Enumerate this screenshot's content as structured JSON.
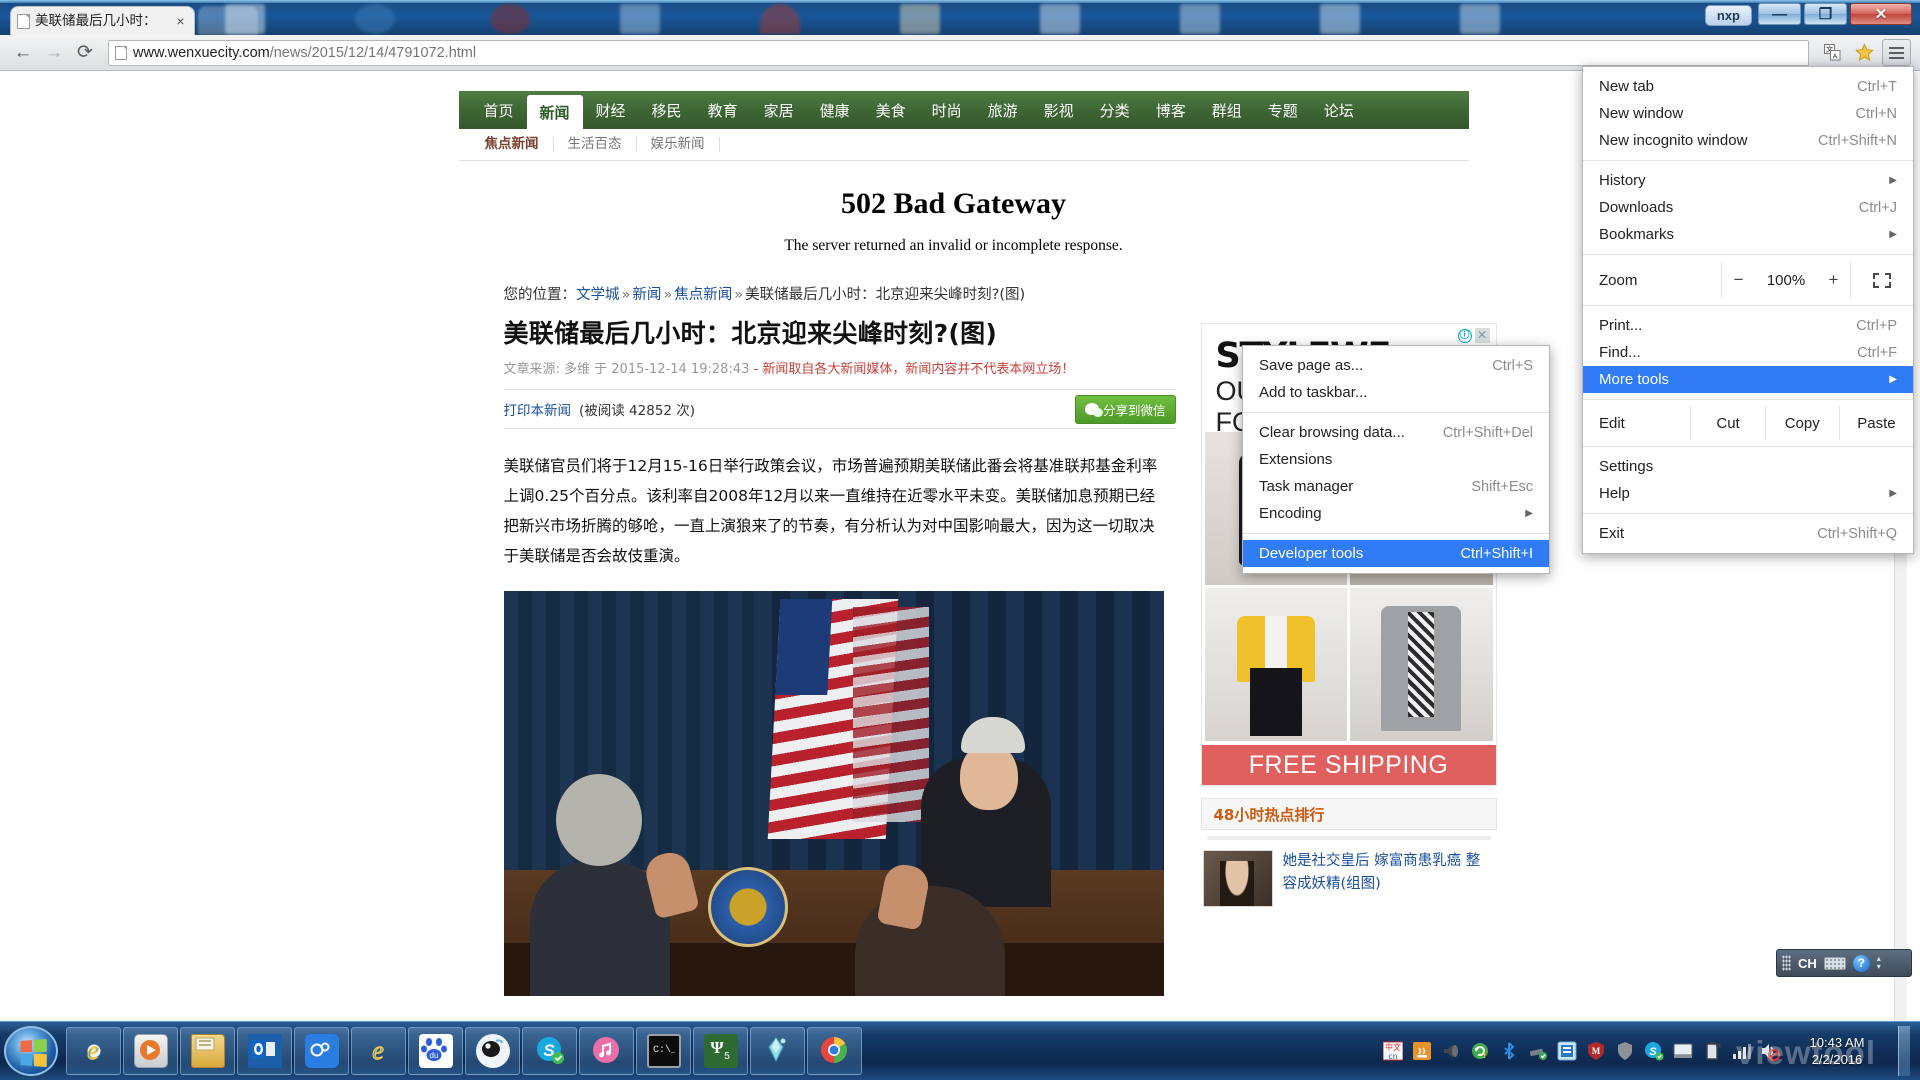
{
  "window": {
    "tab_title": "美联储最后几小时：",
    "tab_close": "×",
    "nxp_badge": "nxp",
    "minimize": "—",
    "maximize": "❐",
    "close": "✕"
  },
  "toolbar": {
    "back": "←",
    "forward": "→",
    "reload": "⟳",
    "url_main": "www.wenxuecity.com",
    "url_path": "/news/2015/12/14/4791072.html",
    "translate_icon": "translate-icon",
    "bookmark_icon": "star-icon",
    "menu_icon": "hamburger-menu-icon"
  },
  "site_nav": {
    "items": [
      {
        "label": "首页",
        "active": false
      },
      {
        "label": "新闻",
        "active": true
      },
      {
        "label": "财经",
        "active": false
      },
      {
        "label": "移民",
        "active": false
      },
      {
        "label": "教育",
        "active": false
      },
      {
        "label": "家居",
        "active": false
      },
      {
        "label": "健康",
        "active": false
      },
      {
        "label": "美食",
        "active": false
      },
      {
        "label": "时尚",
        "active": false
      },
      {
        "label": "旅游",
        "active": false
      },
      {
        "label": "影视",
        "active": false
      },
      {
        "label": "分类",
        "active": false
      },
      {
        "label": "博客",
        "active": false
      },
      {
        "label": "群组",
        "active": false
      },
      {
        "label": "专题",
        "active": false
      },
      {
        "label": "论坛",
        "active": false
      }
    ],
    "subnav": [
      {
        "label": "焦点新闻",
        "active": true
      },
      {
        "label": "生活百态",
        "active": false
      },
      {
        "label": "娱乐新闻",
        "active": false
      }
    ]
  },
  "error": {
    "title": "502 Bad Gateway",
    "subtitle": "The server returned an invalid or incomplete response."
  },
  "breadcrumb": {
    "prefix": "您的位置：",
    "l1": "文学城",
    "l2": "新闻",
    "l3": "焦点新闻",
    "current": "美联储最后几小时：北京迎来尖峰时刻?(图)",
    "sep": "»"
  },
  "article": {
    "title": "美联储最后几小时：北京迎来尖峰时刻?(图)",
    "meta_source": "文章来源: 多维 于 2015-12-14 19:28:43",
    "meta_note": "- 新闻取自各大新闻媒体，新闻内容并不代表本网立场！",
    "print_link": "打印本新闻",
    "read_count": "(被阅读 42852 次)",
    "share_label": "分享到微信",
    "body": "美联储官员们将于12月15-16日举行政策会议，市场普遍预期美联储此番会将基准联邦基金利率上调0.25个百分点。该利率自2008年12月以来一直维持在近零水平未变。美联储加息预期已经把新兴市场折腾的够呛，一直上演狼来了的节奏，有分析认为对中国影响最大，因为这一切取决于美联储是否会故伎重演。"
  },
  "ad": {
    "brand": "STYLEWE",
    "line1": "OUTERWEAR",
    "line2": "FOR W",
    "info_icon": "ⓘ",
    "close_icon": "✕",
    "free_shipping": "FREE SHIPPING"
  },
  "hot": {
    "title": "48小时热点排行",
    "items": [
      {
        "text": "她是社交皇后 嫁富商患乳癌 整容成妖精(组图)"
      }
    ]
  },
  "chrome_menu": {
    "items": [
      {
        "label": "New tab",
        "accel": "Ctrl+T",
        "arrow": false,
        "selected": false
      },
      {
        "label": "New window",
        "accel": "Ctrl+N",
        "arrow": false,
        "selected": false
      },
      {
        "label": "New incognito window",
        "accel": "Ctrl+Shift+N",
        "arrow": false,
        "selected": false
      },
      {
        "label": "History",
        "accel": "",
        "arrow": true,
        "selected": false
      },
      {
        "label": "Downloads",
        "accel": "Ctrl+J",
        "arrow": false,
        "selected": false
      },
      {
        "label": "Bookmarks",
        "accel": "",
        "arrow": true,
        "selected": false
      },
      {
        "label": "Print...",
        "accel": "Ctrl+P",
        "arrow": false,
        "selected": false
      },
      {
        "label": "Find...",
        "accel": "Ctrl+F",
        "arrow": false,
        "selected": false
      },
      {
        "label": "More tools",
        "accel": "",
        "arrow": true,
        "selected": true
      },
      {
        "label": "Settings",
        "accel": "",
        "arrow": false,
        "selected": false
      },
      {
        "label": "Help",
        "accel": "",
        "arrow": true,
        "selected": false
      },
      {
        "label": "Exit",
        "accel": "Ctrl+Shift+Q",
        "arrow": false,
        "selected": false
      }
    ],
    "zoom": {
      "label": "Zoom",
      "minus": "−",
      "value": "100%",
      "plus": "+",
      "fullscreen_icon": "fullscreen-icon"
    },
    "edit": {
      "label": "Edit",
      "cut": "Cut",
      "copy": "Copy",
      "paste": "Paste"
    }
  },
  "more_tools_menu": {
    "items": [
      {
        "label": "Save page as...",
        "accel": "Ctrl+S",
        "arrow": false,
        "selected": false
      },
      {
        "label": "Add to taskbar...",
        "accel": "",
        "arrow": false,
        "selected": false
      },
      {
        "label": "Clear browsing data...",
        "accel": "Ctrl+Shift+Del",
        "arrow": false,
        "selected": false
      },
      {
        "label": "Extensions",
        "accel": "",
        "arrow": false,
        "selected": false
      },
      {
        "label": "Task manager",
        "accel": "Shift+Esc",
        "arrow": false,
        "selected": false
      },
      {
        "label": "Encoding",
        "accel": "",
        "arrow": true,
        "selected": false
      },
      {
        "label": "Developer tools",
        "accel": "Ctrl+Shift+I",
        "arrow": false,
        "selected": true
      }
    ]
  },
  "ime": {
    "language": "CH",
    "keyboard_icon": "keyboard-icon",
    "help_icon": "?",
    "arrows": "▴▾"
  },
  "taskbar": {
    "start_icon": "windows-start-orb",
    "apps": [
      {
        "name": "internet-explorer"
      },
      {
        "name": "media-player"
      },
      {
        "name": "file-explorer"
      },
      {
        "name": "outlook"
      },
      {
        "name": "cloud-app"
      },
      {
        "name": "internet-explorer-2"
      },
      {
        "name": "baidu"
      },
      {
        "name": "eye-app"
      },
      {
        "name": "skype"
      },
      {
        "name": "itunes"
      },
      {
        "name": "command-prompt"
      },
      {
        "name": "ws-app"
      },
      {
        "name": "crystal-app"
      },
      {
        "name": "google-chrome"
      }
    ],
    "tray": [
      {
        "name": "chinese-ime-tray"
      },
      {
        "name": "java-tray"
      },
      {
        "name": "speaker-tray"
      },
      {
        "name": "update-tray"
      },
      {
        "name": "bluetooth-tray"
      },
      {
        "name": "network-device-tray"
      },
      {
        "name": "office-tray"
      },
      {
        "name": "security-shield-tray"
      },
      {
        "name": "defender-tray"
      },
      {
        "name": "skype-tray"
      },
      {
        "name": "display-tray"
      },
      {
        "name": "battery-tray"
      },
      {
        "name": "signal-tray"
      },
      {
        "name": "volume-muted-tray"
      }
    ],
    "time": "10:43 AM",
    "date": "2/2/2016"
  },
  "watermark": "viewtool"
}
